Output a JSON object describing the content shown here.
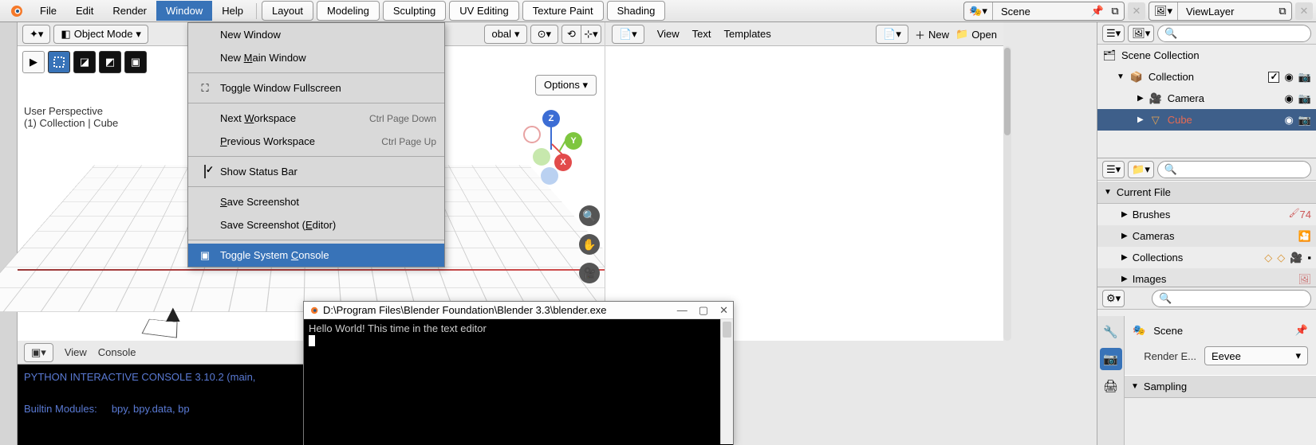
{
  "topmenu": {
    "file": "File",
    "edit": "Edit",
    "render": "Render",
    "window": "Window",
    "help": "Help"
  },
  "workspaces": [
    "Layout",
    "Modeling",
    "Sculpting",
    "UV Editing",
    "Texture Paint",
    "Shading"
  ],
  "scene": {
    "label": "Scene",
    "layer": "ViewLayer"
  },
  "vp3d": {
    "mode": "Object Mode",
    "transform": "obal",
    "overlay1": "User Perspective",
    "overlay2": "(1) Collection | Cube",
    "options": "Options"
  },
  "gizmo": {
    "x": "X",
    "y": "Y",
    "z": "Z"
  },
  "windowMenu": {
    "newWindow": "New Window",
    "newMain": "New Main Window",
    "fullscreen": "Toggle Window Fullscreen",
    "nextWs": "Next Workspace",
    "nextSc": "Ctrl Page Down",
    "prevWs": "Previous Workspace",
    "prevSc": "Ctrl Page Up",
    "statusBar": "Show Status Bar",
    "saveSs": "Save Screenshot",
    "saveSsE": "Save Screenshot (Editor)",
    "toggleConsole": "Toggle System Console"
  },
  "textEditor": {
    "view": "View",
    "text": "Text",
    "templates": "Templates",
    "new": "New",
    "open": "Open"
  },
  "pyconsole": {
    "view": "View",
    "console": "Console",
    "line1": "PYTHON INTERACTIVE CONSOLE 3.10.2 (main,",
    "line2": "Builtin Modules:     bpy, bpy.data, bp"
  },
  "syscon": {
    "title": "D:\\Program Files\\Blender Foundation\\Blender 3.3\\blender.exe",
    "line": "Hello World! This time in the text editor"
  },
  "outliner": {
    "sceneCol": "Scene Collection",
    "collection": "Collection",
    "camera": "Camera",
    "cube": "Cube"
  },
  "assets": {
    "header": "Current File",
    "brushes": "Brushes",
    "cameras": "Cameras",
    "collections": "Collections",
    "images": "Images",
    "brushCount": "74"
  },
  "props": {
    "scene": "Scene",
    "renderE": "Render E...",
    "engine": "Eevee",
    "sampling": "Sampling"
  }
}
